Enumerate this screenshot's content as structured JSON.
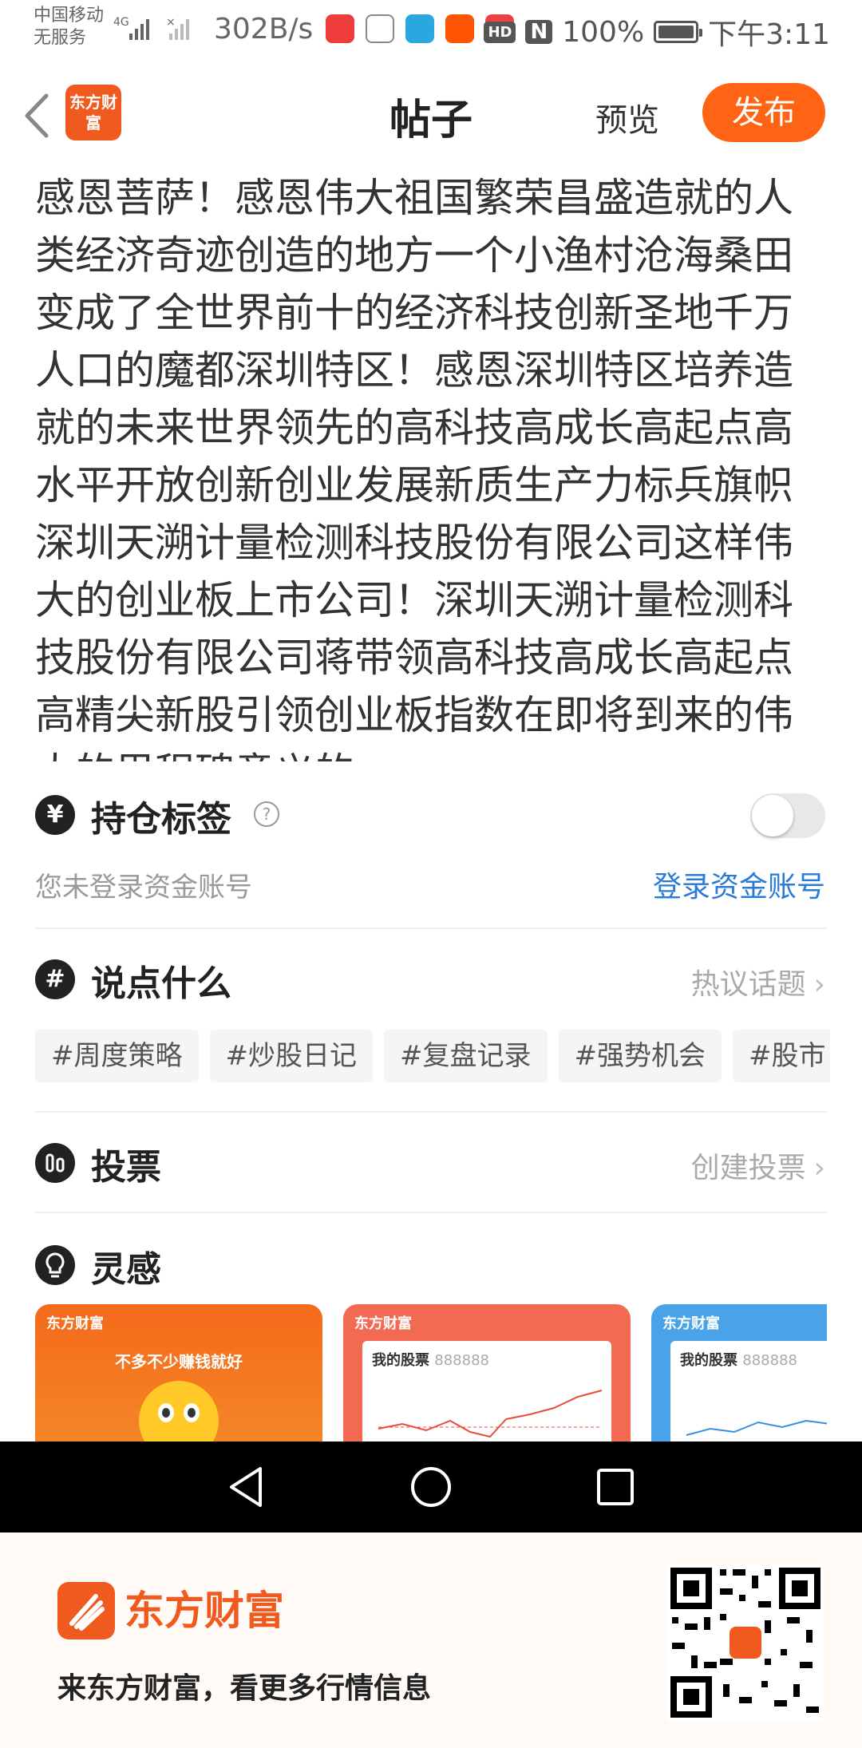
{
  "status_bar": {
    "carrier_line1": "中国移动",
    "carrier_line2": "无服务",
    "network_speed": "302B/s",
    "hd_badge": "HD",
    "nfc_badge": "N",
    "battery": "100%",
    "time": "下午3:11"
  },
  "header": {
    "logo_text": "东方财富",
    "title": "帖子",
    "preview_label": "预览",
    "publish_label": "发布"
  },
  "post": {
    "content": "感恩菩萨！感恩伟大祖国繁荣昌盛造就的人类经济奇迹创造的地方一个小渔村沧海桑田变成了全世界前十的经济科技创新圣地千万人口的魔都深圳特区！感恩深圳特区培养造就的未来世界领先的高科技高成长高起点高水平开放创新创业发展新质生产力标兵旗帜深圳天溯计量检测科技股份有限公司这样伟大的创业板上市公司！深圳天溯计量检测科技股份有限公司蒋带领高科技高成长高起点高精尖新股引领创业板指数在即将到来的伟大的里程碑意义的"
  },
  "holdings": {
    "icon": "¥",
    "title": "持仓标签",
    "help_icon": "?",
    "toggle_on": false,
    "hint": "您未登录资金账号",
    "login_link": "登录资金账号"
  },
  "say_something": {
    "icon": "#",
    "title": "说点什么",
    "link": "热议话题",
    "tags": [
      "#周度策略",
      "#炒股日记",
      "#复盘记录",
      "#强势机会",
      "#股市"
    ]
  },
  "vote": {
    "title": "投票",
    "link": "创建投票"
  },
  "inspiration": {
    "title": "灵感",
    "cards": [
      {
        "brand": "东方财富",
        "slogan": "不多不少赚钱就好"
      },
      {
        "brand": "东方财富",
        "label": "我的股票",
        "code": "888888"
      },
      {
        "brand": "东方财富",
        "label": "我的股票",
        "code": "888888"
      }
    ]
  },
  "promo": {
    "brand": "东方财富",
    "tagline": "来东方财富，看更多行情信息"
  },
  "colors": {
    "accent_orange": "#ff6414",
    "link_blue": "#2a7ad8"
  }
}
